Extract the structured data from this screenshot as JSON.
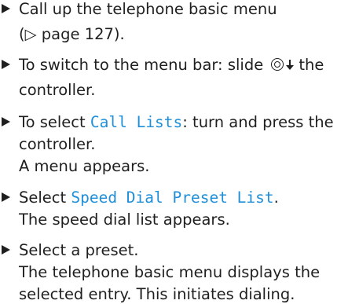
{
  "colors": {
    "text": "#1f1f1f",
    "menu_item": "#1e8fd8"
  },
  "steps": [
    {
      "line1": "Call up the telephone basic menu",
      "line2": "(▷ page 127)."
    },
    {
      "line1_before": "To switch to the menu bar: slide",
      "controller_icon": "controller-slide-down-icon",
      "line1_after": "the",
      "line2": "controller."
    },
    {
      "line1_before": "To select ",
      "line1_menu": "Call Lists",
      "line1_after": ": turn and press the",
      "line2": "controller.",
      "result": "A menu appears."
    },
    {
      "line1_before": "Select ",
      "line1_menu": "Speed Dial Preset List",
      "line1_after": ".",
      "result": "The speed dial list appears."
    },
    {
      "line1": "Select a preset.",
      "result_line1": "The telephone basic menu displays the",
      "result_line2": "selected entry. This initiates dialing."
    }
  ]
}
